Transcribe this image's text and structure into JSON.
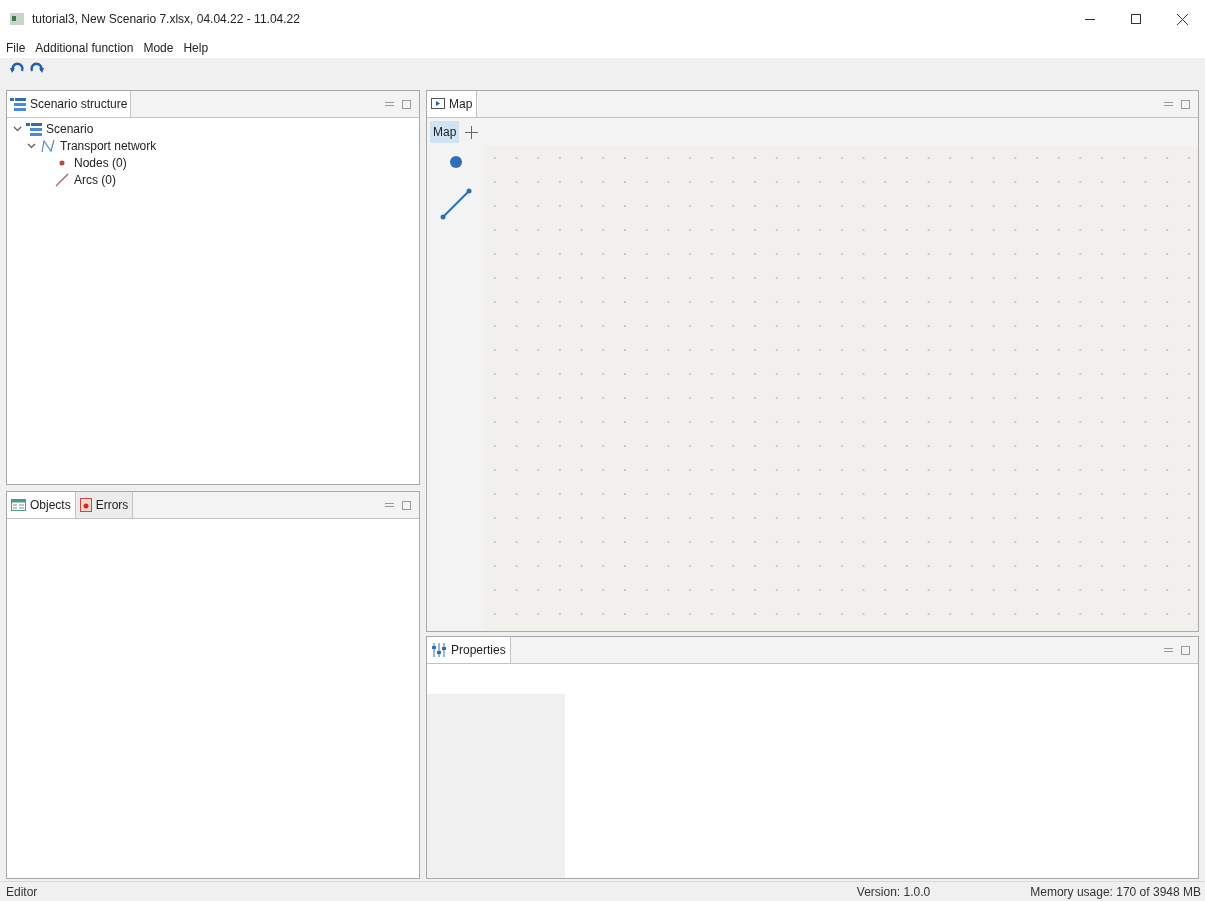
{
  "window": {
    "title": "tutorial3,  New Scenario 7.xlsx, 04.04.22 - 11.04.22"
  },
  "menu": [
    "File",
    "Additional function",
    "Mode",
    "Help"
  ],
  "structure_panel": {
    "tab": "Scenario structure",
    "tree": [
      {
        "label": "Scenario",
        "kind": "scenario",
        "expanded": true,
        "children": [
          {
            "label": "Transport network",
            "kind": "network",
            "expanded": true,
            "children": [
              {
                "label": "Nodes (0)",
                "kind": "nodes"
              },
              {
                "label": "Arcs (0)",
                "kind": "arcs"
              }
            ]
          }
        ]
      }
    ]
  },
  "lower_panel": {
    "tabs": [
      {
        "label": "Objects",
        "kind": "objects",
        "selected": true
      },
      {
        "label": "Errors",
        "kind": "errors",
        "selected": false
      }
    ]
  },
  "map_panel": {
    "tab": "Map",
    "toolbar_label": "Map",
    "toolbar_selected": true
  },
  "properties_panel": {
    "tab": "Properties"
  },
  "status_bar": {
    "mode": "Editor",
    "version": "Version: 1.0.0",
    "memory": "Memory usage: 170 of 3948 MB"
  }
}
